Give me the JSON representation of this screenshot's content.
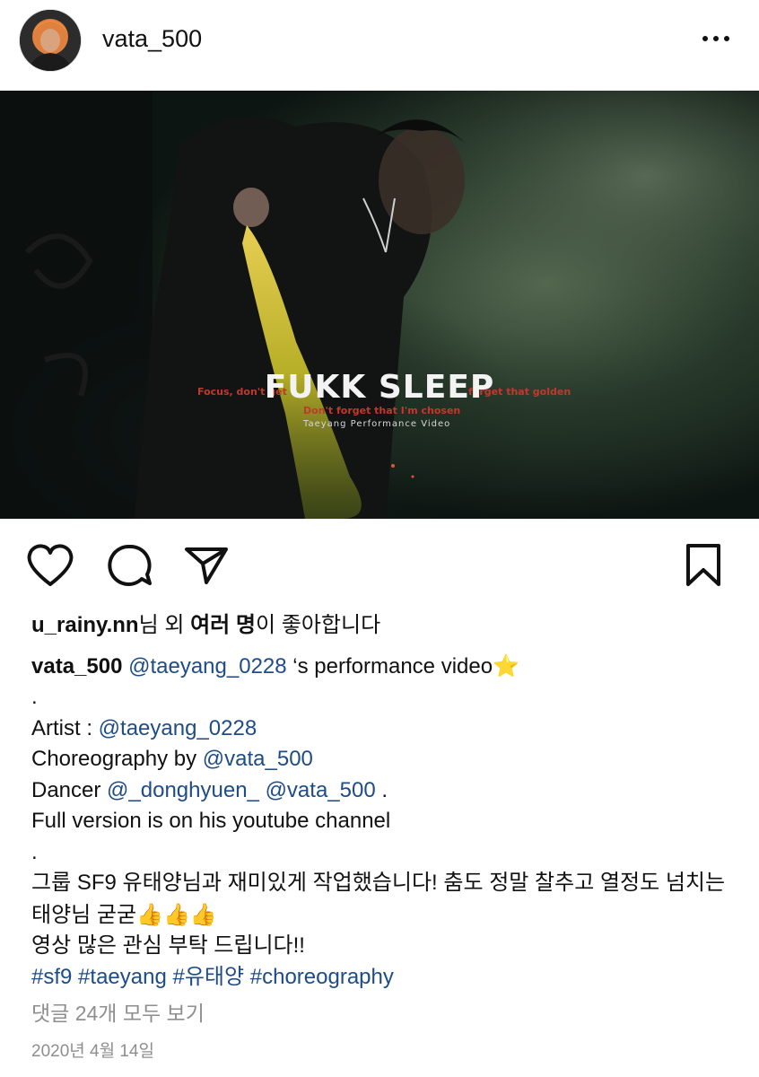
{
  "post": {
    "username": "vata_500",
    "more_icon": "more-horizontal-icon",
    "media": {
      "overlay_title": "FUKK SLEEP",
      "overlay_lyric_1a": "Focus, don't get",
      "overlay_lyric_1b": "forget that golden",
      "overlay_lyric_2": "Don't forget that I'm chosen",
      "overlay_subtitle": "Taeyang Performance Video",
      "mute_icon": "muted-speaker-icon"
    },
    "actions": {
      "like_icon": "heart-icon",
      "comment_icon": "comment-icon",
      "share_icon": "paper-plane-icon",
      "save_icon": "bookmark-icon"
    },
    "likes": {
      "liker": "u_rainy.nn",
      "mid": "님 외 ",
      "others": "여러 명",
      "end": "이 좋아합니다"
    },
    "caption": {
      "author": "vata_500",
      "mention_main": "@taeyang_0228",
      "text_after_mention": " ‘s performance video",
      "star": "⭐",
      "dot1": ".",
      "artist_label": "Artist : ",
      "artist_handle": "@taeyang_0228",
      "choreo_label": "Choreography by ",
      "choreo_handle": "@vata_500",
      "dancer_label": "Dancer ",
      "dancer_handle1": "@_donghyuen_",
      "dancer_handle2": "@vata_500",
      "dancer_end": " .",
      "full_version": "Full version is on his youtube channel",
      "dot2": ".",
      "korean_line1": "그룹 SF9 유태양님과 재미있게 작업했습니다! 춤도 정말 찰추고 열정도 넘치는 태양님 굳굳",
      "thumbs": "👍👍👍",
      "korean_line2": "영상 많은 관심 부탁 드립니다!!",
      "hashtags": [
        "#sf9",
        "#taeyang",
        "#유태양",
        "#choreography"
      ]
    },
    "view_comments": "댓글 24개 모두 보기",
    "date": "2020년 4월 14일"
  },
  "colors": {
    "link": "#1e4c86",
    "muted_text": "#8e8e8e",
    "smoke_green": "#3d5a3a",
    "flare_yellow": "#d8cf2a"
  }
}
